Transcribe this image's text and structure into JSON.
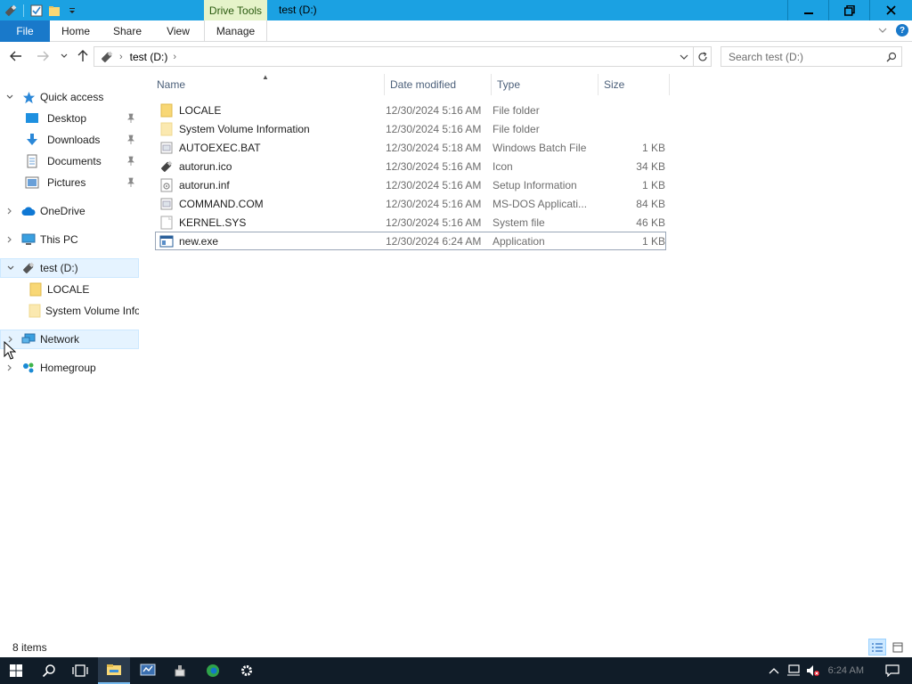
{
  "window": {
    "title": "test (D:)",
    "context_tab": "Drive Tools"
  },
  "ribbon": {
    "file": "File",
    "home": "Home",
    "share": "Share",
    "view": "View",
    "manage": "Manage",
    "help": "?"
  },
  "address": {
    "crumb": "test (D:)"
  },
  "search": {
    "placeholder": "Search test (D:)"
  },
  "nav": {
    "quick_access": "Quick access",
    "desktop": "Desktop",
    "downloads": "Downloads",
    "documents": "Documents",
    "pictures": "Pictures",
    "onedrive": "OneDrive",
    "this_pc": "This PC",
    "drive": "test (D:)",
    "locale": "LOCALE",
    "svi": "System Volume Information",
    "network": "Network",
    "homegroup": "Homegroup"
  },
  "columns": {
    "name": "Name",
    "date": "Date modified",
    "type": "Type",
    "size": "Size"
  },
  "files": [
    {
      "name": "LOCALE",
      "date": "12/30/2024 5:16 AM",
      "type": "File folder",
      "size": "",
      "icon": "folder"
    },
    {
      "name": "System Volume Information",
      "date": "12/30/2024 5:16 AM",
      "type": "File folder",
      "size": "",
      "icon": "folder-light"
    },
    {
      "name": "AUTOEXEC.BAT",
      "date": "12/30/2024 5:18 AM",
      "type": "Windows Batch File",
      "size": "1 KB",
      "icon": "batch"
    },
    {
      "name": "autorun.ico",
      "date": "12/30/2024 5:16 AM",
      "type": "Icon",
      "size": "34 KB",
      "icon": "usb"
    },
    {
      "name": "autorun.inf",
      "date": "12/30/2024 5:16 AM",
      "type": "Setup Information",
      "size": "1 KB",
      "icon": "inf"
    },
    {
      "name": "COMMAND.COM",
      "date": "12/30/2024 5:16 AM",
      "type": "MS-DOS Applicati...",
      "size": "84 KB",
      "icon": "dos"
    },
    {
      "name": "KERNEL.SYS",
      "date": "12/30/2024 5:16 AM",
      "type": "System file",
      "size": "46 KB",
      "icon": "sys"
    },
    {
      "name": "new.exe",
      "date": "12/30/2024 6:24 AM",
      "type": "Application",
      "size": "1 KB",
      "icon": "exe"
    }
  ],
  "status": {
    "items": "8 items"
  },
  "taskbar": {
    "clock": "6:24 AM"
  },
  "colors": {
    "titlebar": "#1ba1e2",
    "file_tab": "#1979ca",
    "context_tab": "#e5f3c9",
    "taskbar": "#101c28",
    "selection": "#e5f3ff"
  }
}
